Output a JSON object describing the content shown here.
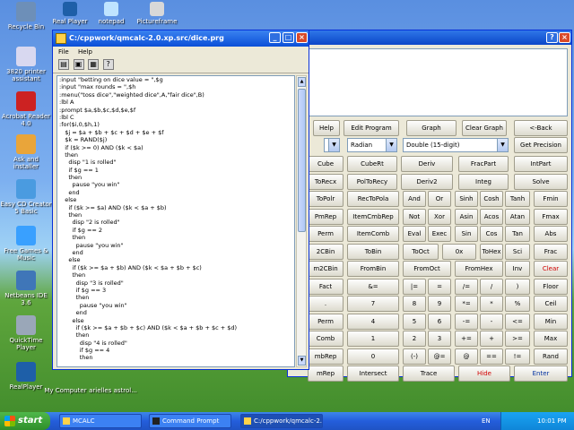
{
  "desktop": {
    "icons": [
      {
        "label": "Recycle Bin",
        "color": "#6d8fb8"
      },
      {
        "label": "3820 printer assistant",
        "color": "#d8d8f0"
      },
      {
        "label": "Acrobat Reader 4.0",
        "color": "#c22"
      },
      {
        "label": "Ask and installer",
        "color": "#e9a53a"
      },
      {
        "label": "Easy CD Creator 5 Basic",
        "color": "#4a9be0"
      },
      {
        "label": "Free Games & Music",
        "color": "#39a0ff"
      },
      {
        "label": "Netbeans IDE 3.6",
        "color": "#3f76b8"
      },
      {
        "label": "QuickTime Player",
        "color": "#9aa7b8"
      },
      {
        "label": "RealPlayer",
        "color": "#1e5fa8"
      }
    ],
    "top_icons": [
      "Real Player",
      "notepad",
      "Pictureframe"
    ],
    "bottom_labels": [
      "My Computer",
      "arielles astrol..."
    ]
  },
  "editor": {
    "title": "C:/cppwork/qmcalc-2.0.xp.src/dice.prg",
    "menu": [
      "File",
      "Help"
    ],
    "code_lines": [
      ":input \"betting on dice value = \",$g",
      ":input \"max rounds = \",$h",
      ":menu(\"toss dice\",\"weighted dice\",A,\"fair dice\",B)",
      ":lbl A",
      ":prompt $a,$b,$c,$d,$e,$f",
      ":lbl C",
      ":for($i,0,$h,1)",
      "   $j = $a + $b + $c + $d + $e + $f",
      "   $k = RAND($j)",
      "   if ($k >= 0) AND ($k < $a)",
      "   then",
      "     disp \"1 is rolled\"",
      "     if $g == 1",
      "     then",
      "       pause \"you win\"",
      "     end",
      "   else",
      "     if ($k >= $a) AND ($k < $a + $b)",
      "     then",
      "       disp \"2 is rolled\"",
      "       if $g == 2",
      "       then",
      "         pause \"you win\"",
      "       end",
      "     else",
      "       if ($k >= $a + $b) AND ($k < $a + $b + $c)",
      "       then",
      "         disp \"3 is rolled\"",
      "         if $g == 3",
      "         then",
      "           pause \"you win\"",
      "         end",
      "       else",
      "         if ($k >= $a + $b + $c) AND ($k < $a + $b + $c + $d)",
      "         then",
      "           disp \"4 is rolled\"",
      "           if $g == 4",
      "           then"
    ]
  },
  "calc": {
    "row1": [
      "Help",
      "Edit Program",
      "Graph",
      "Clear Graph",
      "<-Back"
    ],
    "angle": "Radian",
    "precision_mode": "Double (15-digit)",
    "get_precision": "Get Precision",
    "rows": [
      [
        "Cube",
        "CubeRt",
        "Deriv",
        "FracPart",
        "IntPart"
      ],
      [
        "ToRecx",
        "PolToRecy",
        "Deriv2",
        "Integ",
        "Solve"
      ],
      [
        "ToPolr",
        "RecToPola",
        "And",
        "Or",
        "Sinh",
        "Cosh",
        "Tanh",
        "Fmin"
      ],
      [
        "PmRep",
        "ItemCmbRep",
        "Not",
        "Xor",
        "Asin",
        "Acos",
        "Atan",
        "Fmax"
      ],
      [
        "Perm",
        "ItemComb",
        "Eval",
        "Exec",
        "Sin",
        "Cos",
        "Tan",
        "Abs"
      ],
      [
        "2CBin",
        "ToBin",
        "ToOct",
        "0x",
        "ToHex",
        "Sci",
        "Frac"
      ],
      [
        "m2CBin",
        "FromBin",
        "FromOct",
        "FromHex",
        "Inv",
        "Clear"
      ],
      [
        "Fact",
        "&=",
        "|=",
        "=",
        "/=",
        "/",
        ")",
        "Floor"
      ],
      [
        ".",
        "7",
        "8",
        "9",
        "*=",
        "*",
        "%",
        "Ceil"
      ],
      [
        "Perm",
        "4",
        "5",
        "6",
        "-=",
        "-",
        "<=",
        "Min"
      ],
      [
        "Comb",
        "1",
        "2",
        "3",
        "+=",
        "+",
        ">=",
        "Max"
      ],
      [
        "mbRep",
        "0",
        "(-)",
        "@=",
        "@",
        "==",
        "!=",
        "Rand"
      ]
    ],
    "bottom": [
      "mRep",
      "Intersect",
      "Trace",
      "Hide",
      "Enter"
    ]
  },
  "taskbar": {
    "start": "start",
    "tasks": [
      "MCALC",
      "Command Prompt",
      "C:/cppwork/qmcalc-2..."
    ],
    "lang": "EN",
    "time": "10:01 PM"
  }
}
